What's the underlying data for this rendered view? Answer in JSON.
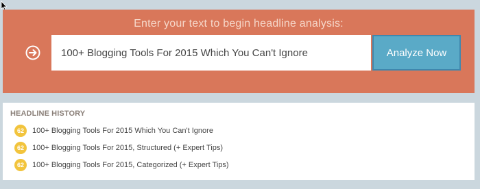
{
  "analysis": {
    "prompt": "Enter your text to begin headline analysis:",
    "input_value": "100+ Blogging Tools For 2015 Which You Can't Ignore",
    "button_label": "Analyze Now",
    "icon": "arrow-right-circle-icon"
  },
  "history": {
    "title": "HEADLINE HISTORY",
    "items": [
      {
        "score": "62",
        "text": "100+ Blogging Tools For 2015 Which You Can't Ignore"
      },
      {
        "score": "62",
        "text": "100+ Blogging Tools For 2015, Structured (+ Expert Tips)"
      },
      {
        "score": "62",
        "text": "100+ Blogging Tools For 2015, Categorized (+ Expert Tips)"
      }
    ]
  },
  "colors": {
    "page_background": "#cbd7de",
    "analysis_panel": "#d9775a",
    "button": "#5aaac7",
    "score_badge": "#f2c43d"
  }
}
